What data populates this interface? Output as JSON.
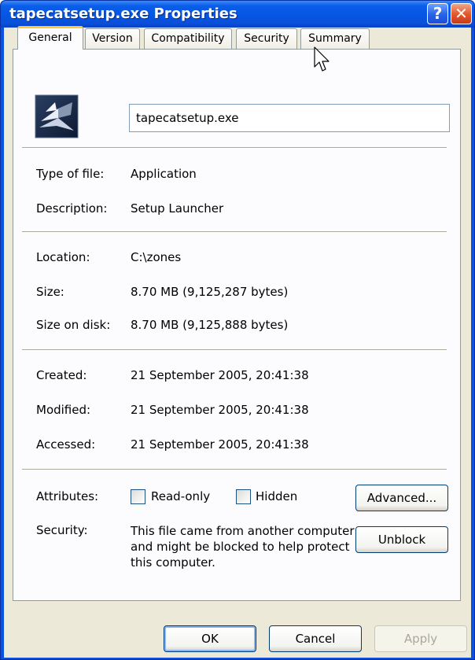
{
  "window": {
    "title": "tapecatsetup.exe Properties",
    "help_label": "?",
    "close_label": "✕"
  },
  "tabs": [
    {
      "label": "General"
    },
    {
      "label": "Version"
    },
    {
      "label": "Compatibility"
    },
    {
      "label": "Security"
    },
    {
      "label": "Summary"
    }
  ],
  "general": {
    "filename": "tapecatsetup.exe",
    "type_label": "Type of file:",
    "type_value": "Application",
    "description_label": "Description:",
    "description_value": "Setup Launcher",
    "location_label": "Location:",
    "location_value": "C:\\zones",
    "size_label": "Size:",
    "size_value": "8.70 MB (9,125,287 bytes)",
    "sizeondisk_label": "Size on disk:",
    "sizeondisk_value": "8.70 MB (9,125,888 bytes)",
    "created_label": "Created:",
    "created_value": "21 September 2005, 20:41:38",
    "modified_label": "Modified:",
    "modified_value": "21 September 2005, 20:41:38",
    "accessed_label": "Accessed:",
    "accessed_value": "21 September 2005, 20:41:38",
    "attributes_label": "Attributes:",
    "readonly_label": "Read-only",
    "hidden_label": "Hidden",
    "advanced_label": "Advanced...",
    "security_label": "Security:",
    "security_text": "This file came from another computer and might be blocked to help protect this computer.",
    "unblock_label": "Unblock"
  },
  "footer": {
    "ok_label": "OK",
    "cancel_label": "Cancel",
    "apply_label": "Apply"
  },
  "colors": {
    "titlebar": "#0556e3",
    "client": "#ece9d8",
    "active_tab_accent": "#ffc73c"
  },
  "icons": {
    "file_icon": "setup-launcher-icon",
    "cursor": "mouse-pointer-icon"
  }
}
